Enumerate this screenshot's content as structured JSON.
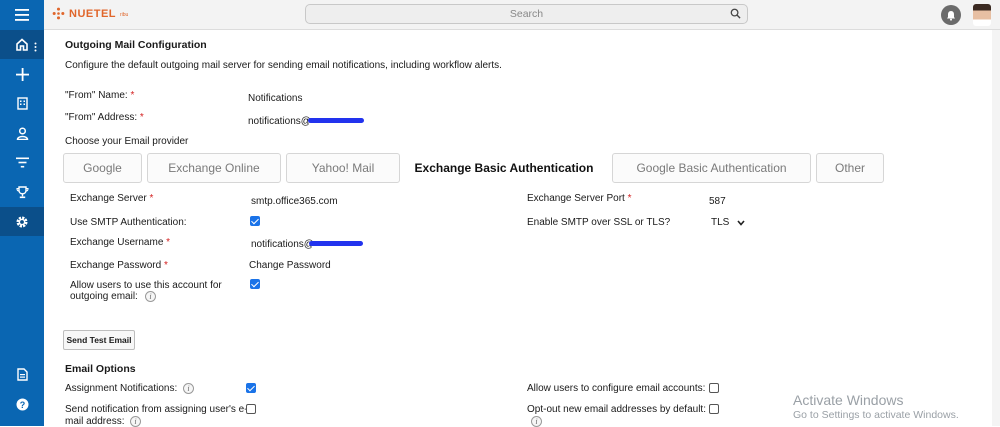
{
  "brand": {
    "logo_text": "NUETEL",
    "logo_suffix": "ribu",
    "accent": "#e0662b"
  },
  "search": {
    "placeholder": "Search"
  },
  "colors": {
    "sidebar": "#0a66b2",
    "sidebar_active": "#0b4f8a",
    "checkbox": "#1a73e8",
    "required": "#d42020"
  },
  "sidebar": {
    "items": [
      "home-icon",
      "plus-icon",
      "building-icon",
      "user-icon",
      "filter-icon",
      "trophy-icon",
      "gear-icon",
      "document-icon",
      "help-icon"
    ]
  },
  "outgoing": {
    "title": "Outgoing Mail Configuration",
    "description": "Configure the default outgoing mail server for sending email notifications, including workflow alerts.",
    "from_name_label": "\"From\" Name:",
    "from_name_value": "Notifications",
    "from_address_label": "\"From\" Address:",
    "from_address_value": "notifications@",
    "provider_label": "Choose your Email provider",
    "providers": [
      "Google",
      "Exchange Online",
      "Yahoo! Mail",
      "Exchange Basic Authentication",
      "Google Basic Authentication",
      "Other"
    ],
    "selected_provider": "Exchange Basic Authentication"
  },
  "exchange": {
    "server_label": "Exchange Server",
    "server_value": "smtp.office365.com",
    "port_label": "Exchange Server Port",
    "port_value": "587",
    "smtp_auth_label": "Use SMTP Authentication:",
    "smtp_auth_checked": true,
    "ssl_label": "Enable SMTP over SSL or TLS?",
    "ssl_value": "TLS",
    "username_label": "Exchange Username",
    "username_value": "notifications@",
    "password_label": "Exchange Password",
    "password_value": "Change Password",
    "allow_users_label_1": "Allow users to use this account for",
    "allow_users_label_2": "outgoing email:",
    "allow_users_checked": true,
    "required_mark": "*"
  },
  "test_button": "Send Test Email",
  "email_options": {
    "title": "Email Options",
    "assignment_label": "Assignment Notifications:",
    "assignment_checked": true,
    "send_from_label_1": "Send notification from assigning user's e-",
    "send_from_label_2": "mail address:",
    "send_from_checked": false,
    "allow_configure_label": "Allow users to configure email accounts:",
    "allow_configure_checked": false,
    "optout_label": "Opt-out new email addresses by default:",
    "optout_checked": false
  },
  "watermark": {
    "line1": "Activate Windows",
    "line2": "Go to Settings to activate Windows."
  }
}
